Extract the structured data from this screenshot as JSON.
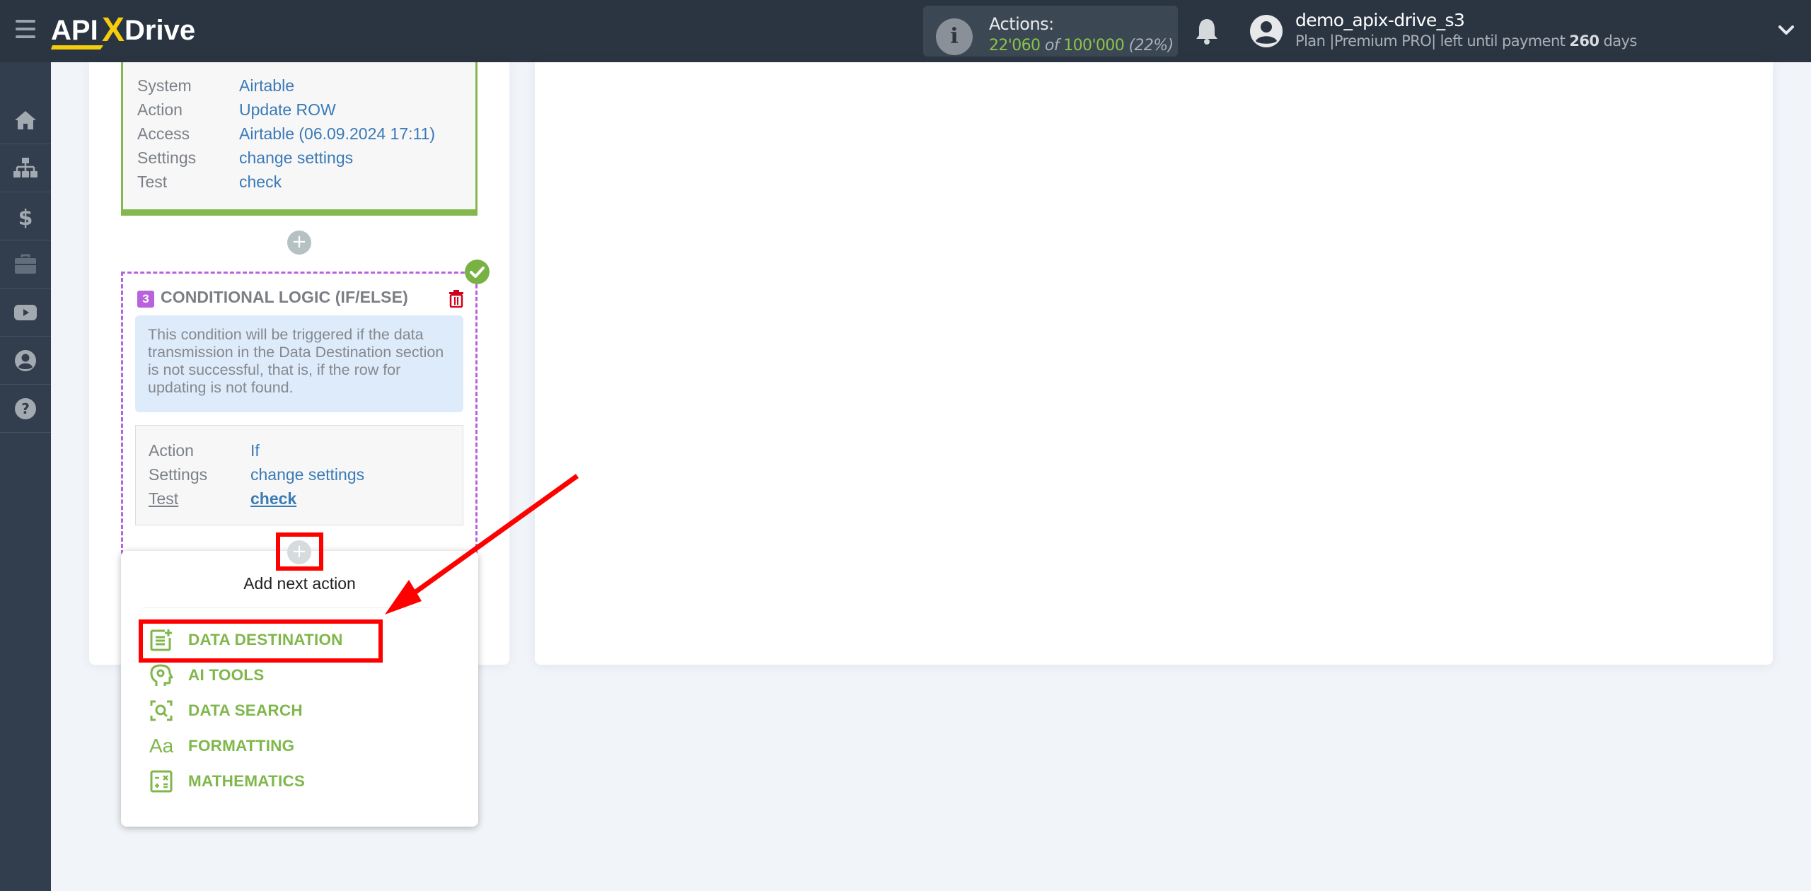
{
  "header": {
    "logo": {
      "part1": "API",
      "x": "X",
      "part2": "Drive"
    },
    "actions": {
      "label": "Actions:",
      "used": "22'060",
      "of": "of",
      "total": "100'000",
      "percent": "(22%)"
    },
    "user": {
      "name": "demo_apix-drive_s3",
      "plan_prefix": "Plan |Premium PRO| left until payment",
      "days": "260",
      "days_suffix": "days"
    },
    "icons": [
      "menu-icon",
      "info-icon",
      "bell-icon",
      "user-avatar-icon",
      "chevron-down-icon"
    ]
  },
  "sidebar": {
    "items": [
      {
        "name": "home",
        "icon": "home-icon"
      },
      {
        "name": "connections",
        "icon": "sitemap-icon"
      },
      {
        "name": "billing",
        "icon": "dollar-icon"
      },
      {
        "name": "tools",
        "icon": "briefcase-icon"
      },
      {
        "name": "videos",
        "icon": "youtube-icon"
      },
      {
        "name": "account",
        "icon": "user-circle-icon"
      },
      {
        "name": "help",
        "icon": "question-circle-icon"
      }
    ]
  },
  "destination_card": {
    "rows": [
      {
        "key": "System",
        "value": "Airtable"
      },
      {
        "key": "Action",
        "value": "Update ROW"
      },
      {
        "key": "Access",
        "value": "Airtable (06.09.2024 17:11)"
      },
      {
        "key": "Settings",
        "value": "change settings"
      },
      {
        "key": "Test",
        "value": "check"
      }
    ],
    "accent_color": "#84b84d"
  },
  "conditional_card": {
    "step_number": "3",
    "title": "CONDITIONAL LOGIC (IF/ELSE)",
    "note": "This condition will be triggered if the data transmission in the Data Destination section is not successful, that is, if the row for updating is not found.",
    "rows": [
      {
        "key": "Action",
        "value": "If"
      },
      {
        "key": "Settings",
        "value": "change settings"
      },
      {
        "key": "Test",
        "value": "check"
      }
    ],
    "accent_color": "#b863de",
    "status": "completed"
  },
  "add_buttons": {
    "label": "+"
  },
  "popup": {
    "title": "Add next action",
    "items": [
      {
        "label": "DATA DESTINATION",
        "icon": "data-destination-icon"
      },
      {
        "label": "AI TOOLS",
        "icon": "ai-tools-icon"
      },
      {
        "label": "DATA SEARCH",
        "icon": "data-search-icon"
      },
      {
        "label": "FORMATTING",
        "icon": "formatting-icon",
        "glyph": "Aa"
      },
      {
        "label": "MATHEMATICS",
        "icon": "mathematics-icon"
      }
    ],
    "item_color": "#7fb74b"
  },
  "annotations": {
    "highlight_color": "#ff0000",
    "highlighted": [
      "add-next-action-button",
      "menu-item-data-destination"
    ]
  }
}
